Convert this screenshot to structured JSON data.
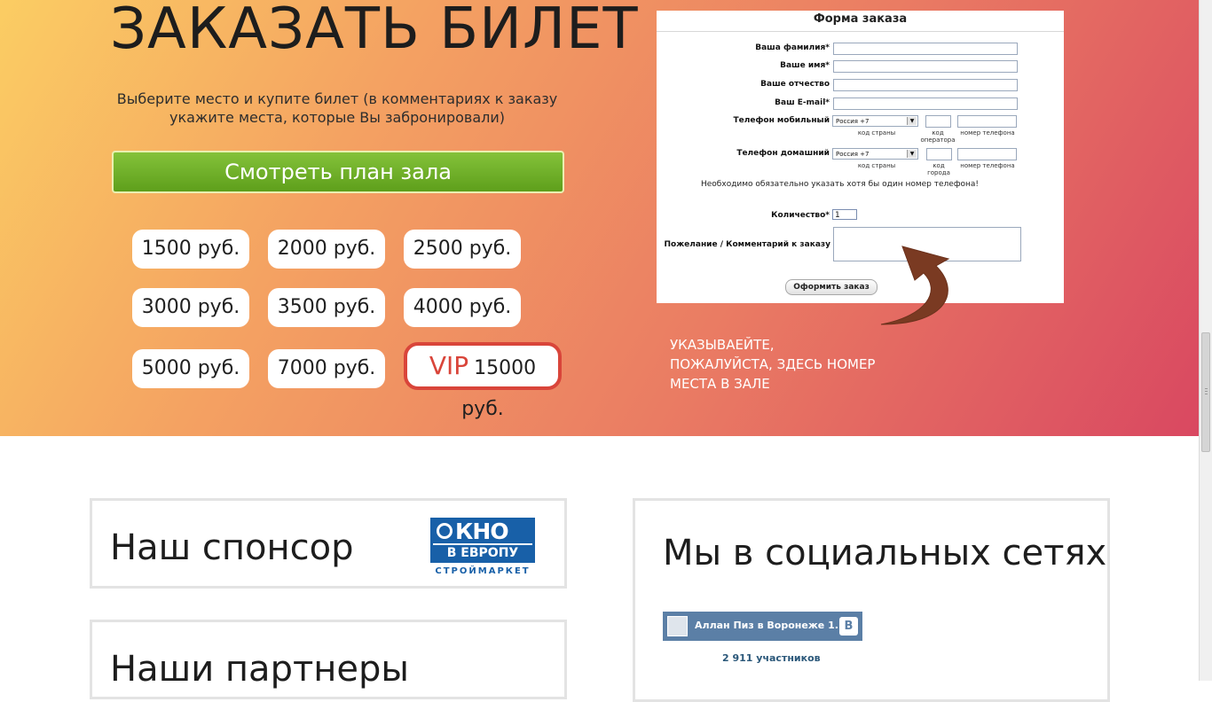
{
  "hero": {
    "title": "ЗАКАЗАТЬ БИЛЕТ",
    "subtitle": "Выберите место и купите билет (в комментариях к заказу укажите места, которые Вы забронировали)",
    "plan_button": "Смотреть план зала",
    "prices": [
      "1500 руб.",
      "2000 руб.",
      "2500 руб.",
      "3000 руб.",
      "3500 руб.",
      "4000 руб.",
      "5000 руб.",
      "7000 руб."
    ],
    "vip": {
      "word": "VIP",
      "price": "15000 руб."
    },
    "hint": [
      "УКАЗЫВАЕЙТЕ,",
      "ПОЖАЛУЙСТА, ЗДЕСЬ НОМЕР",
      "МЕСТА В ЗАЛЕ"
    ]
  },
  "order_form": {
    "title": "Форма заказа",
    "surname_label": "Ваша фамилия*",
    "name_label": "Ваше имя*",
    "patronymic_label": "Ваше отчество",
    "email_label": "Ваш E-mail*",
    "mobile_label": "Телефон мобильный",
    "home_label": "Телефон домашний",
    "country_value": "Россия +7",
    "country_caption": "код страны",
    "operator_caption": "код оператора",
    "city_caption": "код города",
    "number_caption": "номер телефона",
    "phone_note": "Необходимо обязательно указать хотя бы один номер телефона!",
    "quantity_label": "Количество*",
    "quantity_value": "1",
    "comment_label": "Пожелание / Комментарий к заказу",
    "submit": "Оформить заказ"
  },
  "sponsor": {
    "heading": "Наш спонсор",
    "logo_top": "КНО",
    "logo_bottom": "В ЕВРОПУ",
    "logo_sub": "СТРОЙМАРКЕТ"
  },
  "partners": {
    "heading": "Наши партнеры"
  },
  "social": {
    "heading": "Мы в социальных сетях",
    "group_name": "Аллан Пиз в Воронеже 1...",
    "vk_letter": "B",
    "members": "2 911 участников"
  },
  "colors": {
    "hero_start": "#fbcd63",
    "hero_end": "#d94861",
    "plan_button": "#6fb12a",
    "vip_accent": "#d9453a",
    "vk_blue": "#5b7fa6"
  }
}
